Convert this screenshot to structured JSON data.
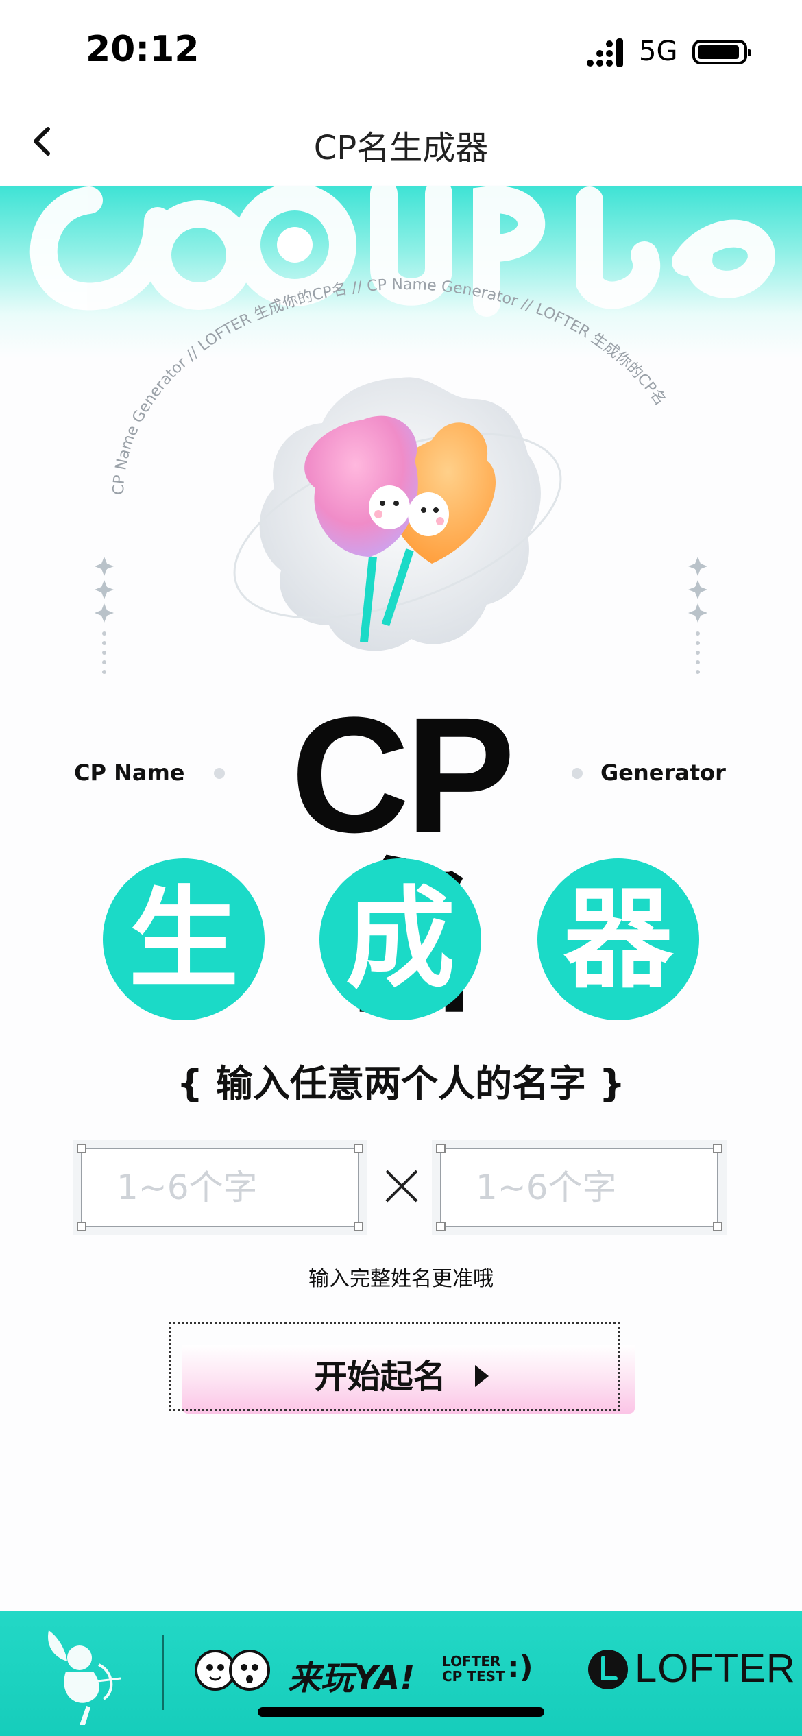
{
  "status_bar": {
    "time": "20:12",
    "network": "5G"
  },
  "nav": {
    "title": "CP名生成器"
  },
  "hero": {
    "arc_text": "CP Name Generator  //  LOFTER  生成你的CP名  //  CP Name Generator  //  LOFTER  生成你的CP名"
  },
  "title": {
    "left_label": "CP Name",
    "right_label": "Generator",
    "big": "CP名",
    "chars": [
      "生",
      "成",
      "器"
    ]
  },
  "form": {
    "prompt": "{   输入任意两个人的名字   }",
    "input1_placeholder": "1~6个字",
    "input2_placeholder": "1~6个字",
    "hint": "输入完整姓名更准哦",
    "start_label": "开始起名"
  },
  "footer": {
    "play": "来玩YA!",
    "lofter_small": "LOFTER",
    "cp_test": "CP TEST",
    "smile": ":)",
    "brand": "LOFTER"
  },
  "colors": {
    "accent": "#1bdac7",
    "pink": "#fbc4e6",
    "text": "#111111"
  }
}
